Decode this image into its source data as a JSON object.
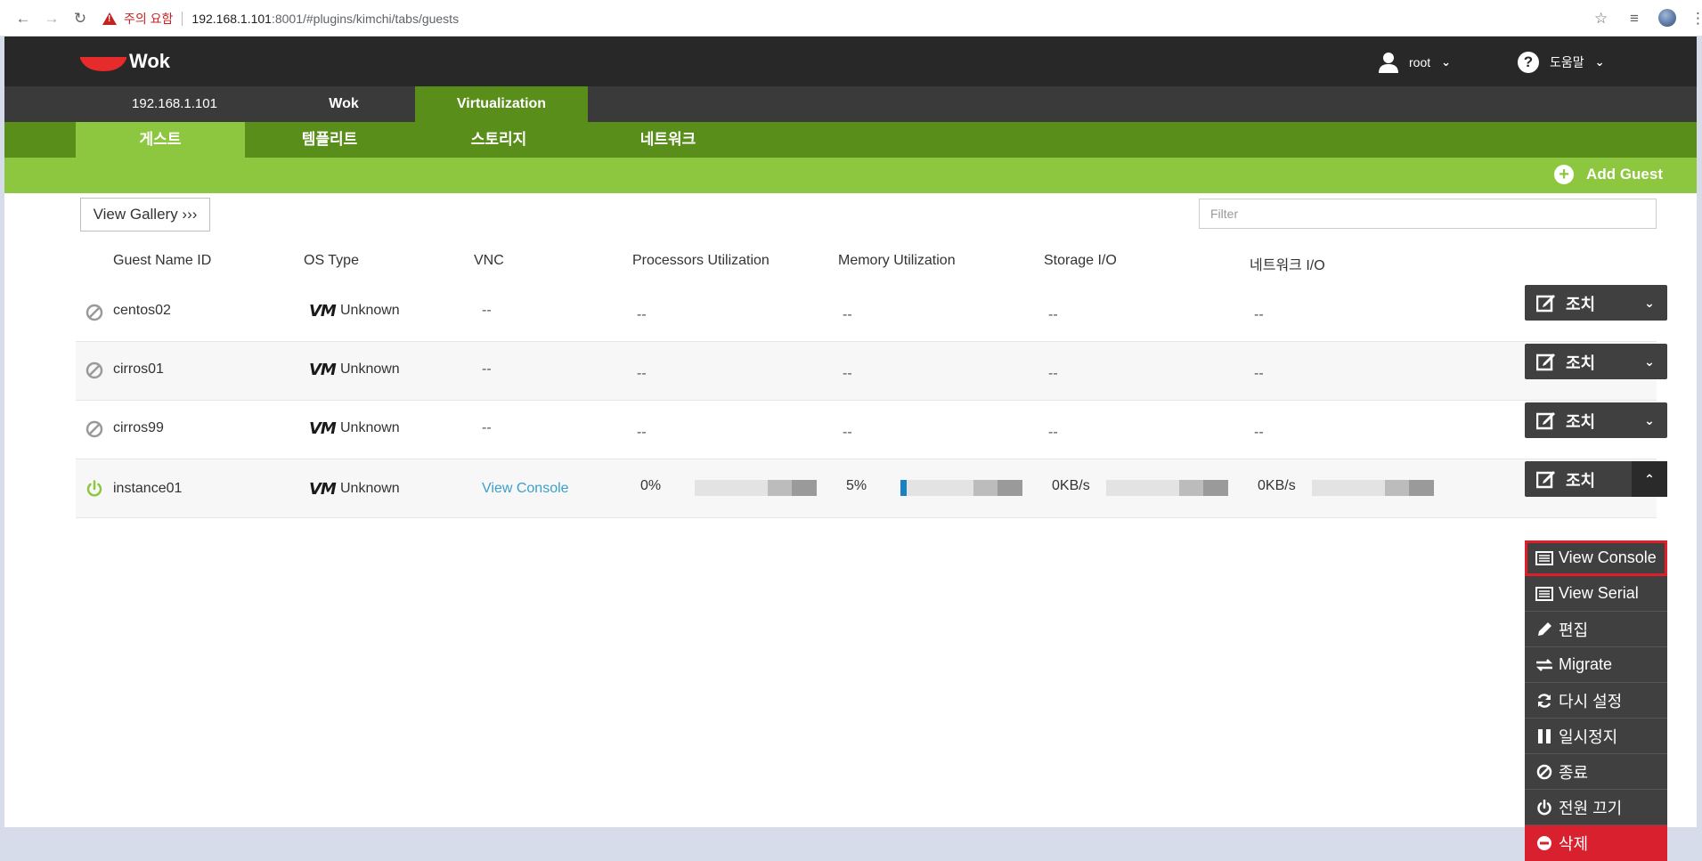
{
  "browser": {
    "warning": "주의 요함",
    "url_host": "192.168.1.101",
    "url_path": ":8001/#plugins/kimchi/tabs/guests"
  },
  "header": {
    "app_name": "Wok",
    "user": "root",
    "help": "도움말"
  },
  "host_tabs": [
    "192.168.1.101",
    "Wok",
    "Virtualization"
  ],
  "sub_tabs": [
    "게스트",
    "템플리트",
    "스토리지",
    "네트워크"
  ],
  "actions": {
    "add_guest": "Add Guest",
    "view_gallery": "View Gallery ›››",
    "filter_placeholder": "Filter"
  },
  "columns": [
    "Guest Name ID",
    "OS Type",
    "VNC",
    "Processors Utilization",
    "Memory Utilization",
    "Storage I/O",
    "네트워크 I/O"
  ],
  "guests": [
    {
      "name": "centos02",
      "os": "Unknown",
      "vnc": "--",
      "cpu": "--",
      "mem": "--",
      "storage": "--",
      "net": "--",
      "action": "조치",
      "running": false
    },
    {
      "name": "cirros01",
      "os": "Unknown",
      "vnc": "--",
      "cpu": "--",
      "mem": "--",
      "storage": "--",
      "net": "--",
      "action": "조치",
      "running": false
    },
    {
      "name": "cirros99",
      "os": "Unknown",
      "vnc": "--",
      "cpu": "--",
      "mem": "--",
      "storage": "--",
      "net": "--",
      "action": "조치",
      "running": false
    },
    {
      "name": "instance01",
      "os": "Unknown",
      "vnc": "View Console",
      "cpu": "0%",
      "mem": "5%",
      "storage": "0KB/s",
      "net": "0KB/s",
      "action": "조치",
      "running": true,
      "cpu_fraction": 0,
      "mem_fraction": 0.05
    }
  ],
  "os_badge": "VM",
  "dropdown": [
    {
      "label": "View Console",
      "icon": "console-icon"
    },
    {
      "label": "View Serial",
      "icon": "serial-icon"
    },
    {
      "label": "편집",
      "icon": "pencil-icon"
    },
    {
      "label": "Migrate",
      "icon": "migrate-icon"
    },
    {
      "label": "다시 설정",
      "icon": "refresh-icon"
    },
    {
      "label": "일시정지",
      "icon": "pause-icon"
    },
    {
      "label": "종료",
      "icon": "shutdown-icon"
    },
    {
      "label": "전원 끄기",
      "icon": "power-icon"
    },
    {
      "label": "삭제",
      "icon": "delete-icon"
    }
  ],
  "colors": {
    "topbar": "#282828",
    "green_dark": "#5a8e1b",
    "green_light": "#8dc63f",
    "danger": "#d8202f",
    "link": "#3aa0c9",
    "running": "#8dc63f"
  }
}
